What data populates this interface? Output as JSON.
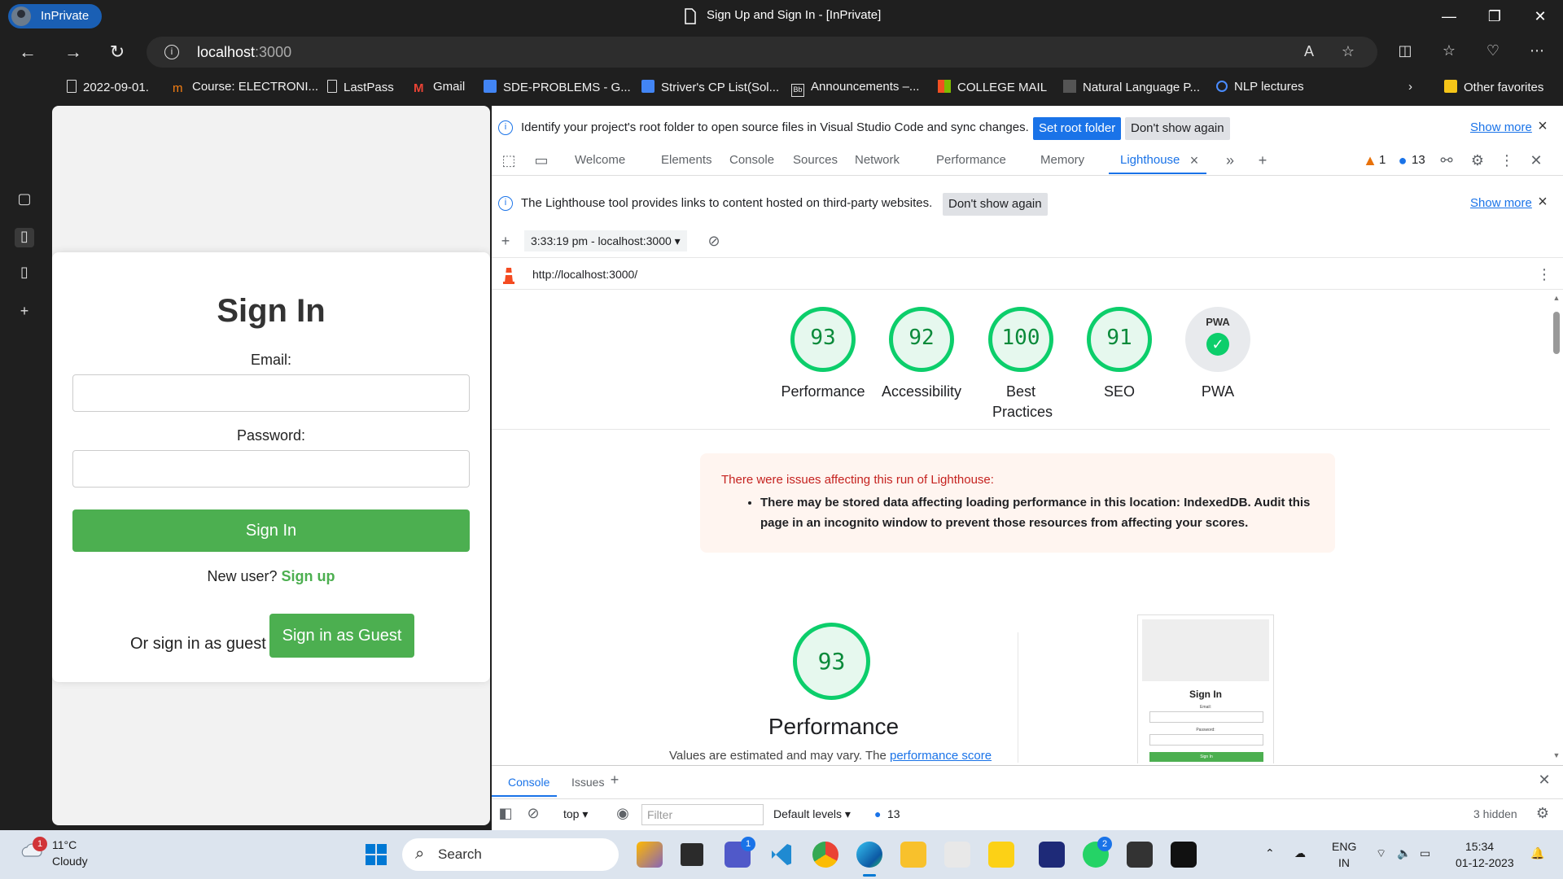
{
  "window": {
    "profile_label": "InPrivate",
    "title": "Sign Up and Sign In - [InPrivate]"
  },
  "address_bar": {
    "host": "localhost",
    "port": ":3000"
  },
  "favorites": [
    {
      "label": "2022-09-01.",
      "icon": "page-icon"
    },
    {
      "label": "Course: ELECTRONI...",
      "icon": "moodle-icon"
    },
    {
      "label": "LastPass",
      "icon": "page-icon"
    },
    {
      "label": "Gmail",
      "icon": "gmail-icon"
    },
    {
      "label": "SDE-PROBLEMS - G...",
      "icon": "docs-icon"
    },
    {
      "label": "Striver's CP List(Sol...",
      "icon": "docs-icon"
    },
    {
      "label": "Announcements –...",
      "icon": "blackboard-icon"
    },
    {
      "label": "COLLEGE MAIL",
      "icon": "microsoft-icon"
    },
    {
      "label": "Natural Language P...",
      "icon": "site-icon"
    },
    {
      "label": "NLP lectures",
      "icon": "site-icon"
    },
    {
      "label": "Other favorites",
      "icon": "folder-icon"
    }
  ],
  "signin": {
    "title": "Sign In",
    "email_label": "Email:",
    "password_label": "Password:",
    "signin_button": "Sign In",
    "new_user_text": "New user?",
    "signup_link": "Sign up",
    "guest_text": "Or sign in as guest",
    "guest_button": "Sign in as Guest"
  },
  "devtools": {
    "infobar1": {
      "text": "Identify your project's root folder to open source files in Visual Studio Code and sync changes.",
      "primary": "Set root folder",
      "secondary": "Don't show again",
      "show_more": "Show more"
    },
    "tabs": [
      "Welcome",
      "Elements",
      "Console",
      "Sources",
      "Network",
      "Performance",
      "Memory",
      "Lighthouse"
    ],
    "warnings_count": "1",
    "messages_count": "13",
    "infobar2": {
      "text": "The Lighthouse tool provides links to content hosted on third-party websites.",
      "secondary": "Don't show again",
      "show_more": "Show more"
    },
    "run_select": "3:33:19 pm - localhost:3000",
    "report_url": "http://localhost:3000/",
    "scores": [
      {
        "value": "93",
        "label": "Performance"
      },
      {
        "value": "92",
        "label": "Accessibility"
      },
      {
        "value": "100",
        "label": "Best Practices"
      },
      {
        "value": "91",
        "label": "SEO"
      }
    ],
    "pwa": {
      "badge": "PWA",
      "label": "PWA"
    },
    "warning": {
      "title": "There were issues affecting this run of Lighthouse:",
      "item": "There may be stored data affecting loading performance in this location: IndexedDB. Audit this page in an incognito window to prevent those resources from affecting your scores."
    },
    "perf_section": {
      "score": "93",
      "title": "Performance",
      "note": "Values are estimated and may vary. The",
      "link": "performance score"
    },
    "thumbnail": {
      "title": "Sign In",
      "email": "Email:",
      "password": "Password:",
      "button": "Sign In"
    },
    "drawer": {
      "tabs": [
        "Console",
        "Issues"
      ],
      "context": "top",
      "filter_placeholder": "Filter",
      "levels": "Default levels",
      "count": "13",
      "hidden": "3 hidden"
    }
  },
  "taskbar": {
    "weather_temp": "11°C",
    "weather_desc": "Cloudy",
    "weather_badge": "1",
    "search_label": "Search",
    "teams_badge": "1",
    "whatsapp_badge": "2",
    "lang_line1": "ENG",
    "lang_line2": "IN",
    "time": "15:34",
    "date": "01-12-2023"
  }
}
